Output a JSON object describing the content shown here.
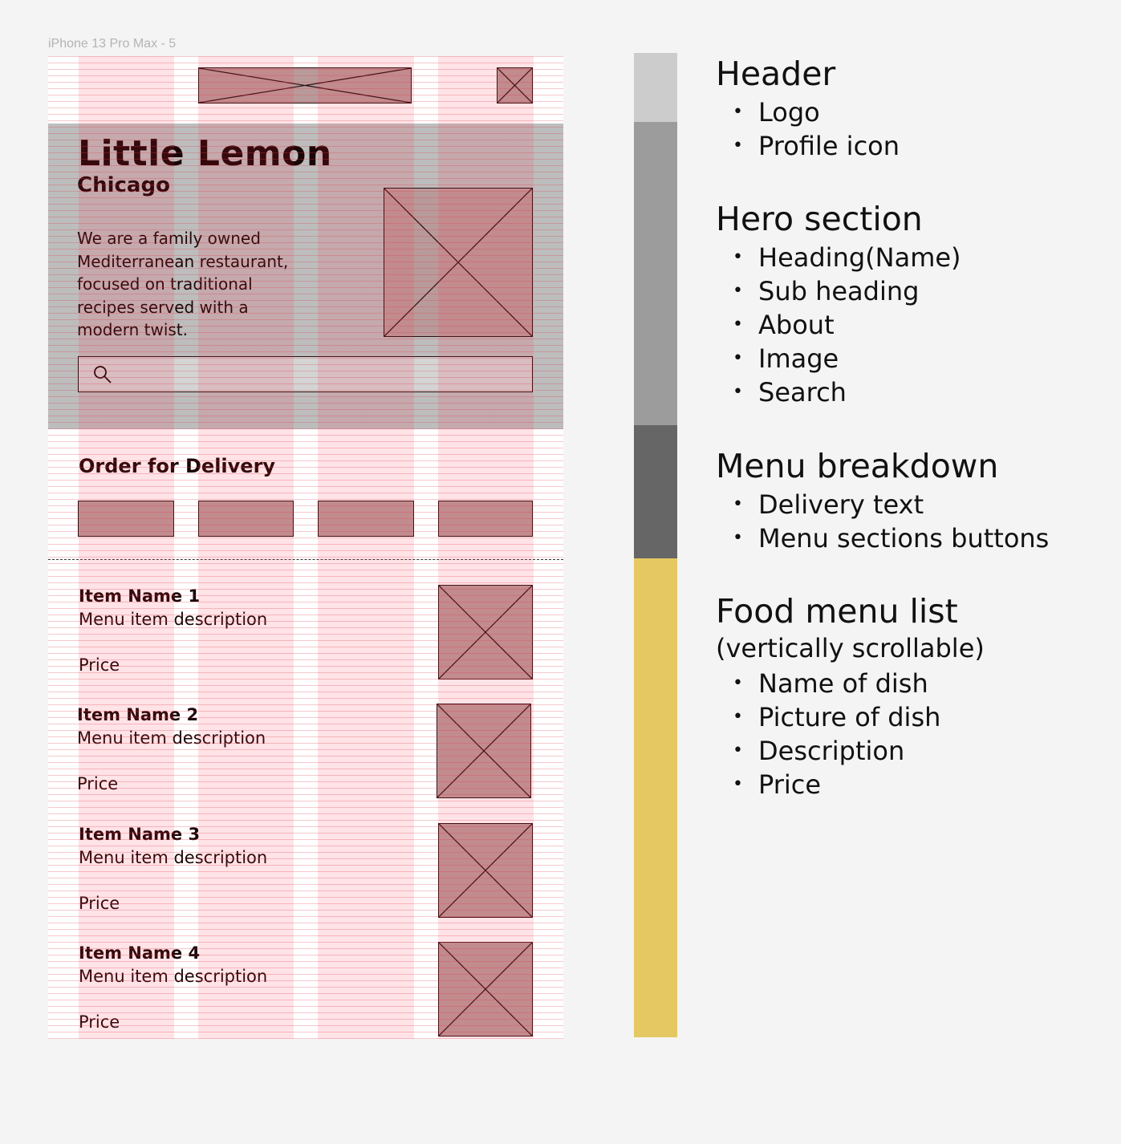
{
  "frame_label": "iPhone 13 Pro Max - 5",
  "hero": {
    "title": "Little Lemon",
    "subtitle": "Chicago",
    "about": "We are a family owned\nMediterranean restaurant,\nfocused on traditional\nrecipes served with a\nmodern twist."
  },
  "delivery": {
    "title": "Order for Delivery"
  },
  "menu_items": [
    {
      "name": "Item Name 1",
      "description": "Menu item description",
      "price": "Price"
    },
    {
      "name": "Item Name 2",
      "description": "Menu item description",
      "price": "Price"
    },
    {
      "name": "Item Name 3",
      "description": "Menu item description",
      "price": "Price"
    },
    {
      "name": "Item Name 4",
      "description": "Menu item description",
      "price": "Price"
    }
  ],
  "colors": {
    "header_bar": "#cccccc",
    "hero_bar": "#9c9c9c",
    "menu_breakdown_bar": "#666666",
    "food_list_bar": "#e6c862",
    "placeholder_fill": "#b99a9a"
  },
  "legend": {
    "header": {
      "title": "Header",
      "items": [
        "Logo",
        "Profile icon"
      ]
    },
    "hero": {
      "title": "Hero section",
      "items": [
        "Heading(Name)",
        "Sub heading",
        "About",
        "Image",
        "Search"
      ]
    },
    "menu_breakdown": {
      "title": "Menu breakdown",
      "items": [
        "Delivery text",
        "Menu sections buttons"
      ]
    },
    "food_list": {
      "title": "Food menu list",
      "subtitle": "(vertically scrollable)",
      "items": [
        "Name of dish",
        "Picture of dish",
        "Description",
        "Price"
      ]
    }
  }
}
